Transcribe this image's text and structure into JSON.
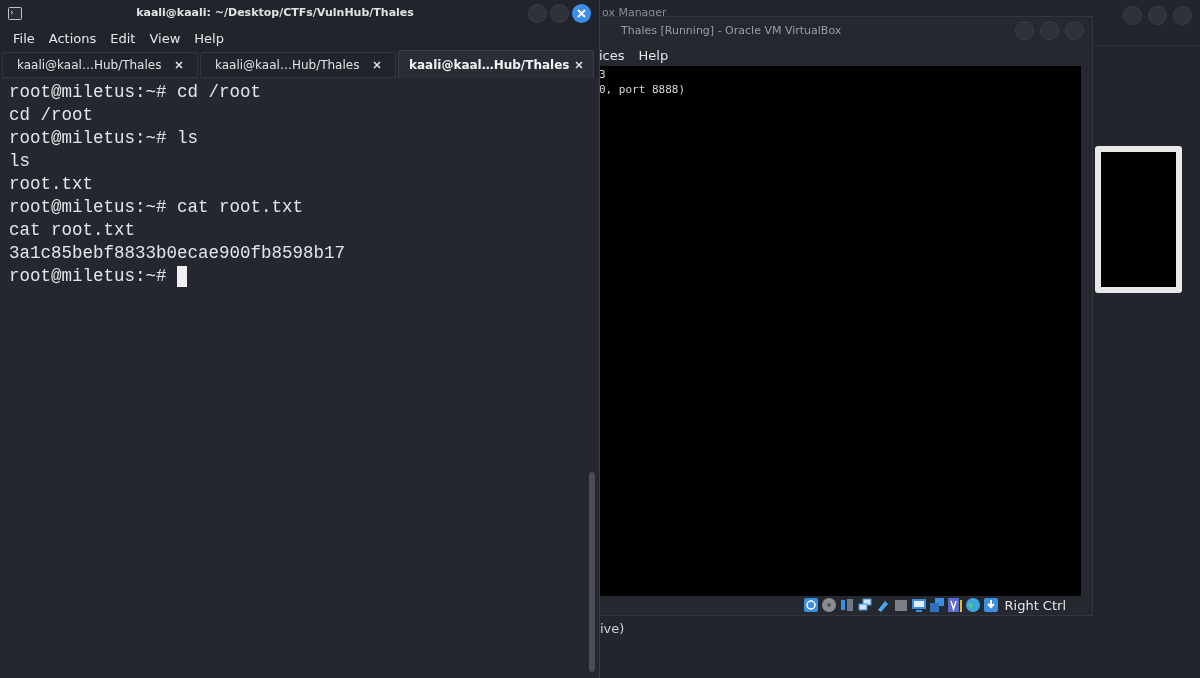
{
  "vbox_manager": {
    "title": "ox Manager",
    "text_fragment": "ive)"
  },
  "vm_window": {
    "title": "Thales [Running] - Oracle VM VirtualBox",
    "menu": [
      "ices",
      "Help"
    ],
    "screen_lines": [
      "3",
      "0, port 8888)"
    ],
    "host_key": "Right Ctrl"
  },
  "terminal": {
    "title": "kaali@kaali: ~/Desktop/CTFs/VulnHub/Thales",
    "menu": [
      "File",
      "Actions",
      "Edit",
      "View",
      "Help"
    ],
    "tabs": [
      {
        "label": "kaali@kaal…Hub/Thales",
        "selected": false
      },
      {
        "label": "kaali@kaal…Hub/Thales",
        "selected": false
      },
      {
        "label": "kaali@kaal…Hub/Thales",
        "selected": true
      }
    ],
    "lines": [
      "root@miletus:~# cd /root",
      "cd /root",
      "root@miletus:~# ls",
      "ls",
      "root.txt",
      "root@miletus:~# cat root.txt",
      "cat root.txt",
      "3a1c85bebf8833b0ecae900fb8598b17",
      "root@miletus:~# "
    ],
    "cursor": true
  }
}
